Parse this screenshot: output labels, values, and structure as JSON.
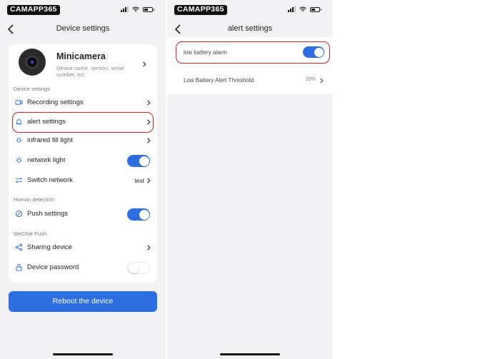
{
  "watermark": "CAMAPP365",
  "colors": {
    "accent": "#2c6ee0",
    "highlight": "#c9252b",
    "background": "#f2f2f4"
  },
  "device_settings": {
    "title": "Device settings",
    "device": {
      "name": "Minicamera",
      "description": "Device name, version, serial number, etc."
    },
    "sections": {
      "device_settings": "Device settings",
      "human_detection": "Human detection",
      "wechat_push": "WeChat Push"
    },
    "rows": {
      "recording": {
        "label": "Recording settings",
        "icon": "video-icon"
      },
      "alert": {
        "label": "alert settings",
        "icon": "bell-icon"
      },
      "infrared": {
        "label": "infrared fill light",
        "icon": "light-icon"
      },
      "network_light": {
        "label": "network light",
        "icon": "light-icon",
        "enabled": true
      },
      "switch_network": {
        "label": "Switch network",
        "value": "test",
        "icon": "switch-icon"
      },
      "push": {
        "label": "Push settings",
        "icon": "push-icon",
        "enabled": true
      },
      "sharing": {
        "label": "Sharing device",
        "icon": "share-icon"
      },
      "password": {
        "label": "Device password",
        "icon": "lock-icon",
        "enabled": false
      }
    },
    "reboot_label": "Reboot the device"
  },
  "alert_settings": {
    "title": "alert settings",
    "low_battery_alarm": {
      "label": "low battery alarm",
      "enabled": true
    },
    "threshold": {
      "label": "Low Battery Alert Threshold",
      "value": "20%"
    }
  }
}
